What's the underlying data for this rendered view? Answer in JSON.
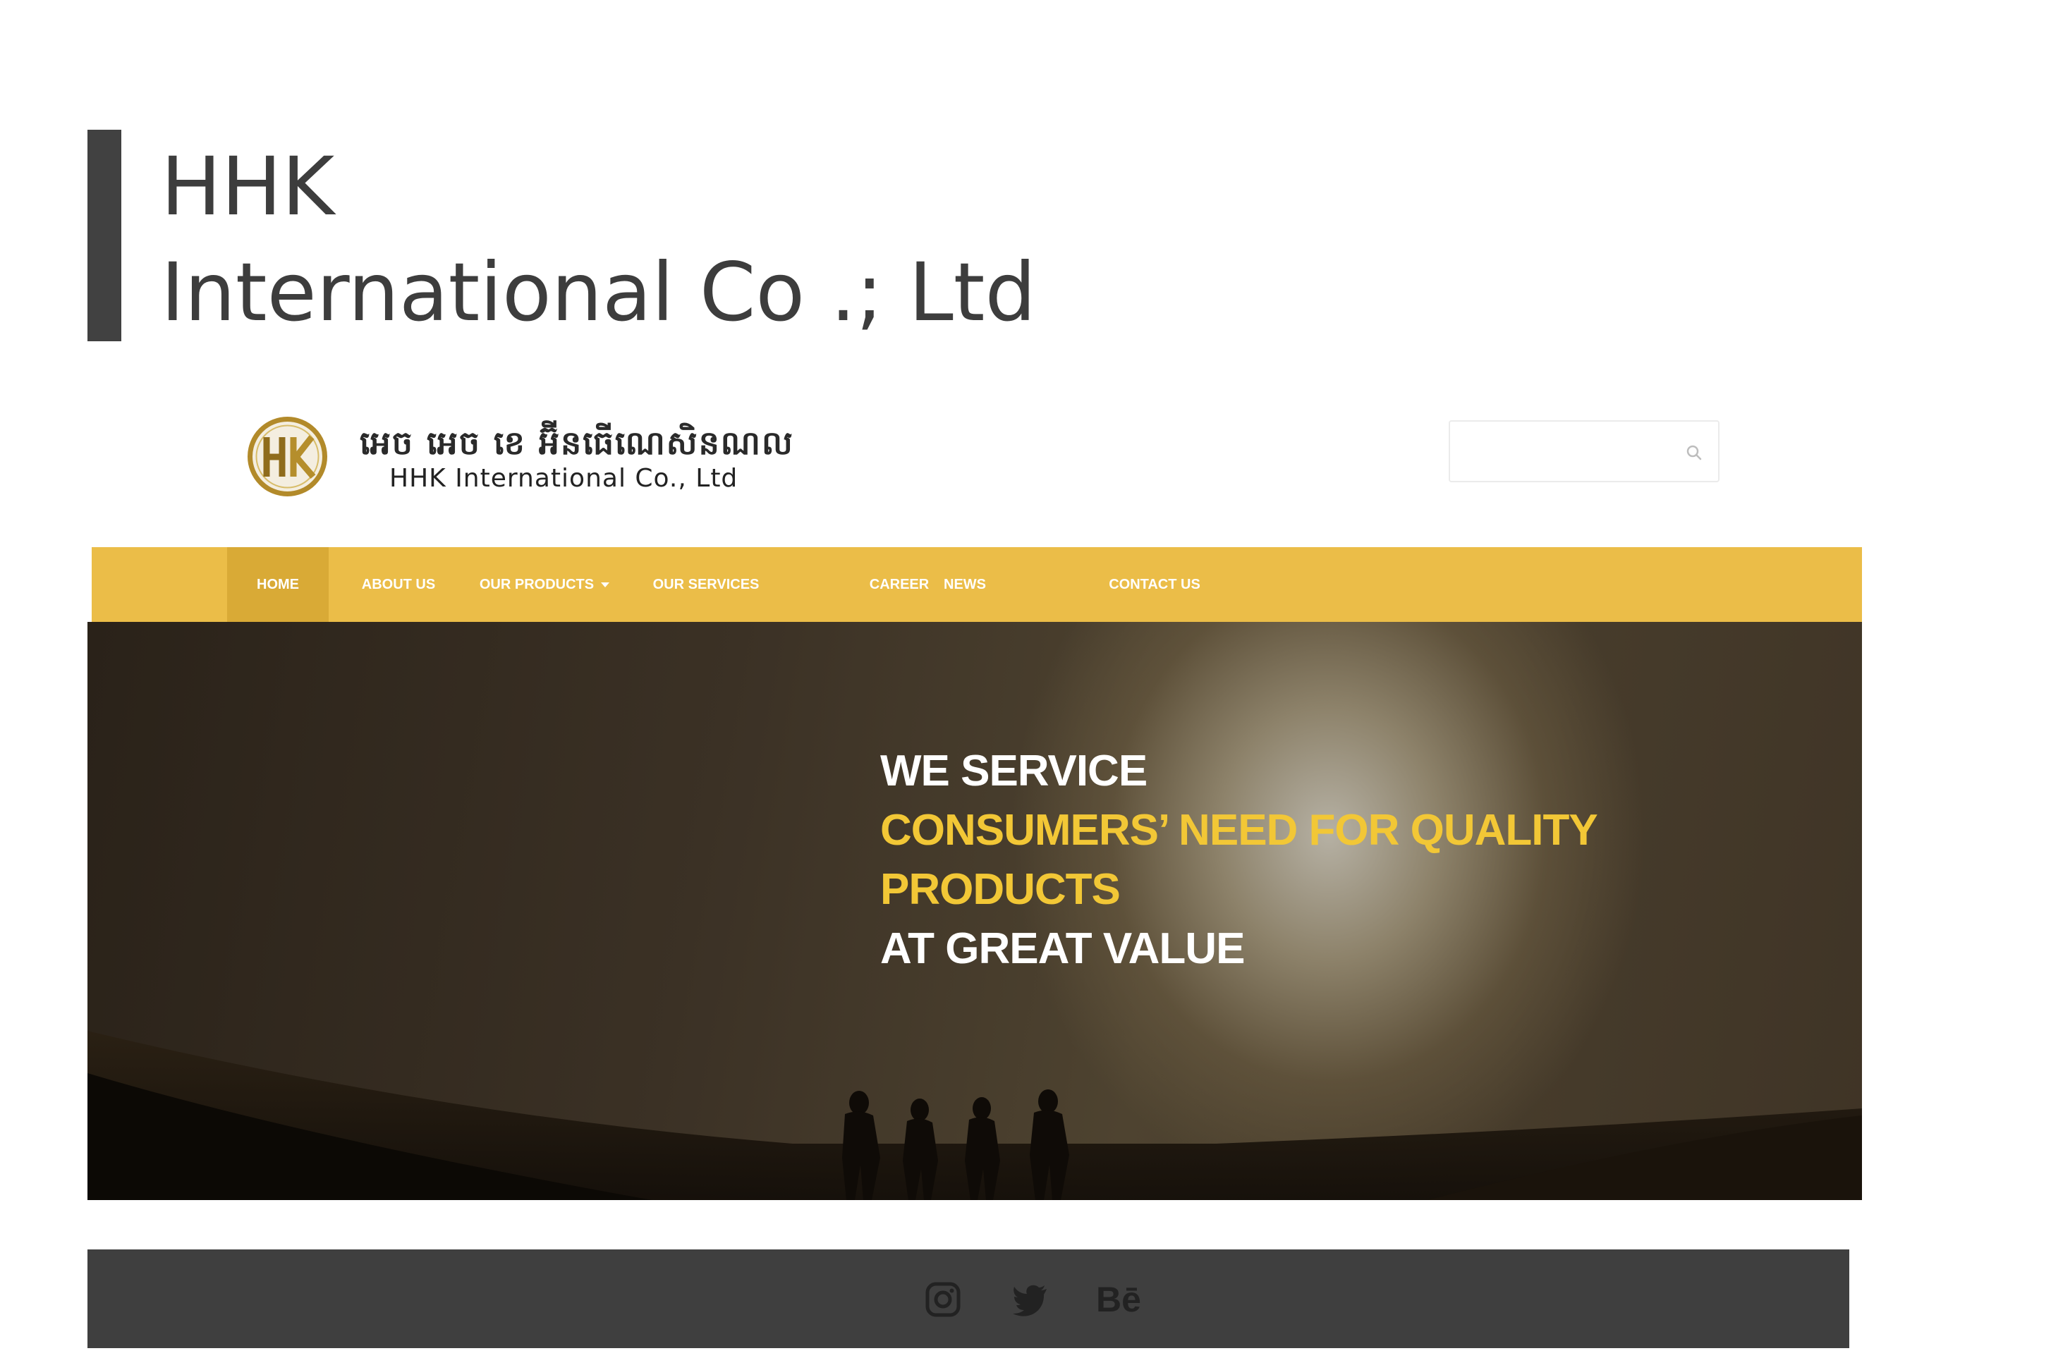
{
  "portfolio": {
    "title_line1": "HHK",
    "title_line2": "International Co .; Ltd",
    "accent_color": "#414141"
  },
  "header": {
    "logo_icon": "hhk-gold-circle-logo",
    "logo_khmer": "អេច អេច ខេ អ៊ីនធើណេសិនណល",
    "logo_english": "HHK International Co., Ltd",
    "search": {
      "placeholder": "",
      "value": "",
      "icon": "search-icon"
    }
  },
  "nav": {
    "items": [
      {
        "label": "HOME",
        "active": true
      },
      {
        "label": "ABOUT US"
      },
      {
        "label": "OUR PRODUCTS",
        "has_dropdown": true
      },
      {
        "label": "OUR SERVICES"
      },
      {
        "label": "CAREER"
      },
      {
        "label": "NEWS"
      },
      {
        "label": "CONTACT US"
      }
    ],
    "bar_color": "#ebbd48",
    "active_color": "#d9aa36"
  },
  "hero": {
    "line1": "WE SERVICE",
    "line2": "CONSUMERS’ NEED FOR QUALITY",
    "line3": "PRODUCTS",
    "line4": "AT GREAT VALUE",
    "highlight_color": "#f2c736"
  },
  "footer": {
    "social": [
      {
        "icon": "instagram-icon"
      },
      {
        "icon": "twitter-icon"
      },
      {
        "icon": "behance-icon",
        "label": "Bē"
      }
    ],
    "bar_color": "#3f3f3f"
  }
}
